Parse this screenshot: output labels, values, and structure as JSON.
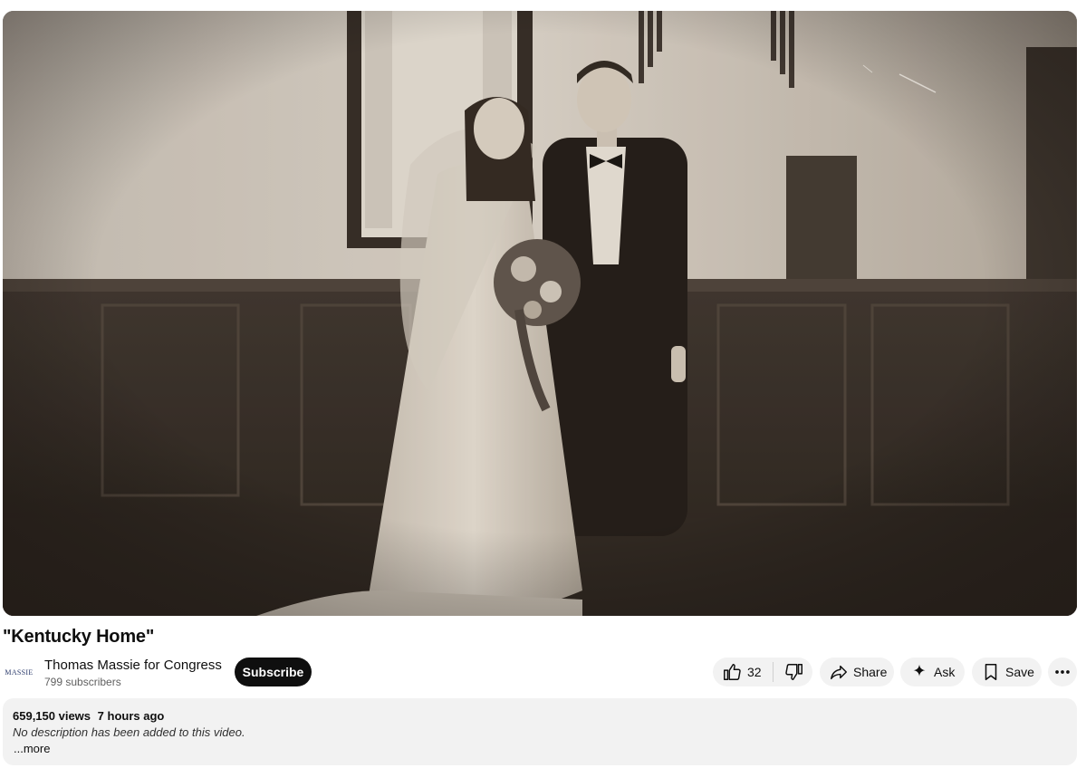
{
  "video": {
    "title": "\"Kentucky Home\"",
    "thumbnail_description": "sepia wedding photo of bride and groom"
  },
  "channel": {
    "avatar_text": "MASSIE",
    "name": "Thomas Massie for Congress",
    "subscribers": "799 subscribers",
    "subscribe_label": "Subscribe"
  },
  "actions": {
    "like_count": "32",
    "share_label": "Share",
    "ask_label": "Ask",
    "save_label": "Save"
  },
  "description": {
    "views": "659,150 views",
    "age": "7 hours ago",
    "text": "No description has been added to this video.",
    "more_label": "...more"
  },
  "icons": {
    "like": "thumbs-up-icon",
    "dislike": "thumbs-down-icon",
    "share": "share-arrow-icon",
    "ask": "sparkle-icon",
    "save": "bookmark-icon",
    "more": "more-horizontal-icon"
  }
}
